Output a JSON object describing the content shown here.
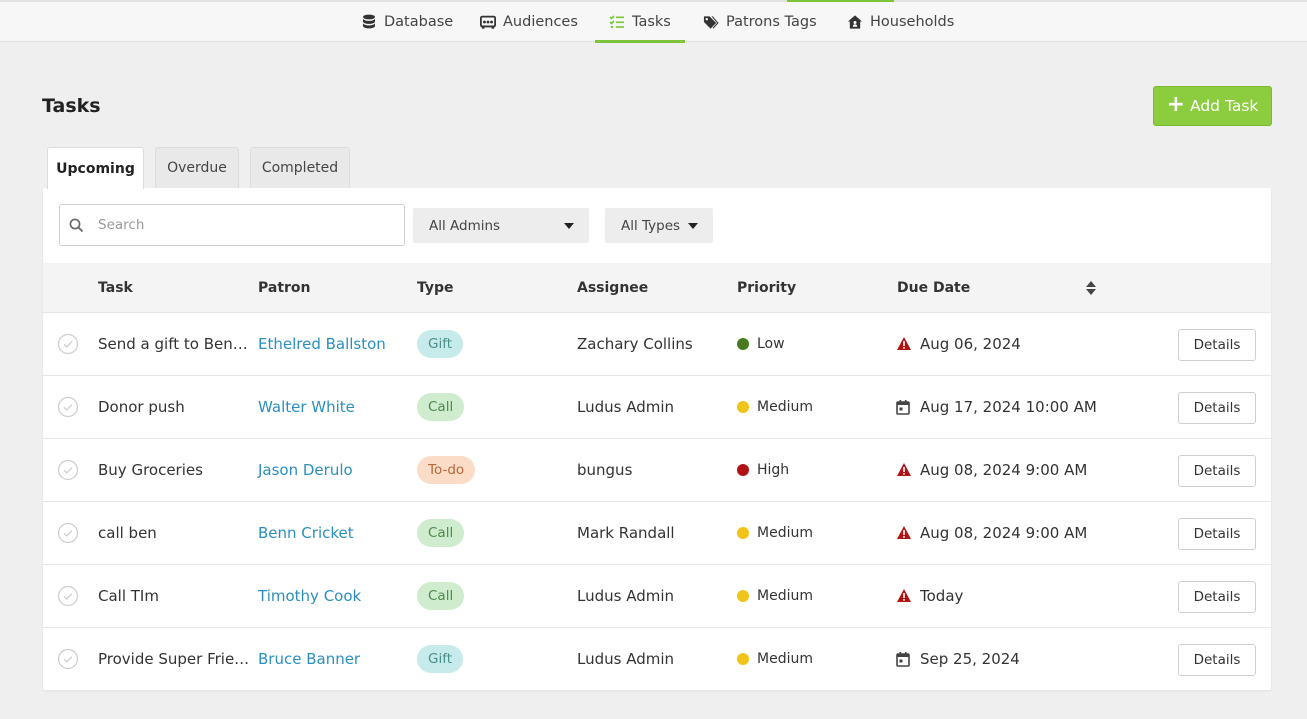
{
  "nav": {
    "items": [
      {
        "label": "Database",
        "icon": "database-icon"
      },
      {
        "label": "Audiences",
        "icon": "audiences-icon"
      },
      {
        "label": "Tasks",
        "icon": "tasks-icon"
      },
      {
        "label": "Patrons Tags",
        "icon": "tags-icon"
      },
      {
        "label": "Households",
        "icon": "household-icon"
      }
    ],
    "active": "Tasks"
  },
  "page": {
    "title": "Tasks",
    "add_button": "Add Task"
  },
  "tabs": [
    "Upcoming",
    "Overdue",
    "Completed"
  ],
  "filters": {
    "search_placeholder": "Search",
    "admins": "All Admins",
    "types": "All Types"
  },
  "table": {
    "headers": {
      "task": "Task",
      "patron": "Patron",
      "type": "Type",
      "assignee": "Assignee",
      "priority": "Priority",
      "due_date": "Due Date"
    },
    "details_label": "Details",
    "rows": [
      {
        "task": "Send a gift to Benny",
        "patron": "Ethelred Ballston",
        "type": "Gift",
        "assignee": "Zachary Collins",
        "priority": "Low",
        "due": "Aug 06, 2024",
        "due_icon": "warning-icon"
      },
      {
        "task": "Donor push",
        "patron": "Walter White",
        "type": "Call",
        "assignee": "Ludus Admin",
        "priority": "Medium",
        "due": "Aug 17, 2024 10:00 AM",
        "due_icon": "calendar-icon"
      },
      {
        "task": "Buy Groceries",
        "patron": "Jason Derulo",
        "type": "To-do",
        "assignee": "bungus",
        "priority": "High",
        "due": "Aug 08, 2024 9:00 AM",
        "due_icon": "warning-icon"
      },
      {
        "task": "call ben",
        "patron": "Benn Cricket",
        "type": "Call",
        "assignee": "Mark Randall",
        "priority": "Medium",
        "due": "Aug 08, 2024 9:00 AM",
        "due_icon": "warning-icon"
      },
      {
        "task": "Call TIm",
        "patron": "Timothy Cook",
        "type": "Call",
        "assignee": "Ludus Admin",
        "priority": "Medium",
        "due": "Today",
        "due_icon": "warning-icon"
      },
      {
        "task": "Provide Super Friends...",
        "patron": "Bruce Banner",
        "type": "Gift",
        "assignee": "Ludus Admin",
        "priority": "Medium",
        "due": "Sep 25, 2024",
        "due_icon": "calendar-icon"
      }
    ]
  },
  "colors": {
    "accent": "#8ccc3f",
    "link": "#2a8fbf",
    "priority_low": "#4a7a1e",
    "priority_medium": "#f0c419",
    "priority_high": "#b01313",
    "warning": "#b01313",
    "type_gift_bg": "#c7ebea",
    "type_call_bg": "#cfeccf",
    "type_todo_bg": "#fbdcc7"
  }
}
